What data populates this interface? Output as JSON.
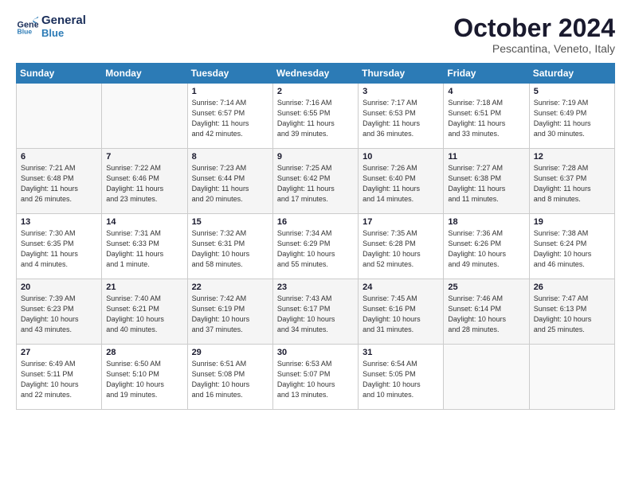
{
  "header": {
    "logo_line1": "General",
    "logo_line2": "Blue",
    "month_title": "October 2024",
    "location": "Pescantina, Veneto, Italy"
  },
  "weekdays": [
    "Sunday",
    "Monday",
    "Tuesday",
    "Wednesday",
    "Thursday",
    "Friday",
    "Saturday"
  ],
  "weeks": [
    [
      {
        "day": "",
        "info": ""
      },
      {
        "day": "",
        "info": ""
      },
      {
        "day": "1",
        "info": "Sunrise: 7:14 AM\nSunset: 6:57 PM\nDaylight: 11 hours\nand 42 minutes."
      },
      {
        "day": "2",
        "info": "Sunrise: 7:16 AM\nSunset: 6:55 PM\nDaylight: 11 hours\nand 39 minutes."
      },
      {
        "day": "3",
        "info": "Sunrise: 7:17 AM\nSunset: 6:53 PM\nDaylight: 11 hours\nand 36 minutes."
      },
      {
        "day": "4",
        "info": "Sunrise: 7:18 AM\nSunset: 6:51 PM\nDaylight: 11 hours\nand 33 minutes."
      },
      {
        "day": "5",
        "info": "Sunrise: 7:19 AM\nSunset: 6:49 PM\nDaylight: 11 hours\nand 30 minutes."
      }
    ],
    [
      {
        "day": "6",
        "info": "Sunrise: 7:21 AM\nSunset: 6:48 PM\nDaylight: 11 hours\nand 26 minutes."
      },
      {
        "day": "7",
        "info": "Sunrise: 7:22 AM\nSunset: 6:46 PM\nDaylight: 11 hours\nand 23 minutes."
      },
      {
        "day": "8",
        "info": "Sunrise: 7:23 AM\nSunset: 6:44 PM\nDaylight: 11 hours\nand 20 minutes."
      },
      {
        "day": "9",
        "info": "Sunrise: 7:25 AM\nSunset: 6:42 PM\nDaylight: 11 hours\nand 17 minutes."
      },
      {
        "day": "10",
        "info": "Sunrise: 7:26 AM\nSunset: 6:40 PM\nDaylight: 11 hours\nand 14 minutes."
      },
      {
        "day": "11",
        "info": "Sunrise: 7:27 AM\nSunset: 6:38 PM\nDaylight: 11 hours\nand 11 minutes."
      },
      {
        "day": "12",
        "info": "Sunrise: 7:28 AM\nSunset: 6:37 PM\nDaylight: 11 hours\nand 8 minutes."
      }
    ],
    [
      {
        "day": "13",
        "info": "Sunrise: 7:30 AM\nSunset: 6:35 PM\nDaylight: 11 hours\nand 4 minutes."
      },
      {
        "day": "14",
        "info": "Sunrise: 7:31 AM\nSunset: 6:33 PM\nDaylight: 11 hours\nand 1 minute."
      },
      {
        "day": "15",
        "info": "Sunrise: 7:32 AM\nSunset: 6:31 PM\nDaylight: 10 hours\nand 58 minutes."
      },
      {
        "day": "16",
        "info": "Sunrise: 7:34 AM\nSunset: 6:29 PM\nDaylight: 10 hours\nand 55 minutes."
      },
      {
        "day": "17",
        "info": "Sunrise: 7:35 AM\nSunset: 6:28 PM\nDaylight: 10 hours\nand 52 minutes."
      },
      {
        "day": "18",
        "info": "Sunrise: 7:36 AM\nSunset: 6:26 PM\nDaylight: 10 hours\nand 49 minutes."
      },
      {
        "day": "19",
        "info": "Sunrise: 7:38 AM\nSunset: 6:24 PM\nDaylight: 10 hours\nand 46 minutes."
      }
    ],
    [
      {
        "day": "20",
        "info": "Sunrise: 7:39 AM\nSunset: 6:23 PM\nDaylight: 10 hours\nand 43 minutes."
      },
      {
        "day": "21",
        "info": "Sunrise: 7:40 AM\nSunset: 6:21 PM\nDaylight: 10 hours\nand 40 minutes."
      },
      {
        "day": "22",
        "info": "Sunrise: 7:42 AM\nSunset: 6:19 PM\nDaylight: 10 hours\nand 37 minutes."
      },
      {
        "day": "23",
        "info": "Sunrise: 7:43 AM\nSunset: 6:17 PM\nDaylight: 10 hours\nand 34 minutes."
      },
      {
        "day": "24",
        "info": "Sunrise: 7:45 AM\nSunset: 6:16 PM\nDaylight: 10 hours\nand 31 minutes."
      },
      {
        "day": "25",
        "info": "Sunrise: 7:46 AM\nSunset: 6:14 PM\nDaylight: 10 hours\nand 28 minutes."
      },
      {
        "day": "26",
        "info": "Sunrise: 7:47 AM\nSunset: 6:13 PM\nDaylight: 10 hours\nand 25 minutes."
      }
    ],
    [
      {
        "day": "27",
        "info": "Sunrise: 6:49 AM\nSunset: 5:11 PM\nDaylight: 10 hours\nand 22 minutes."
      },
      {
        "day": "28",
        "info": "Sunrise: 6:50 AM\nSunset: 5:10 PM\nDaylight: 10 hours\nand 19 minutes."
      },
      {
        "day": "29",
        "info": "Sunrise: 6:51 AM\nSunset: 5:08 PM\nDaylight: 10 hours\nand 16 minutes."
      },
      {
        "day": "30",
        "info": "Sunrise: 6:53 AM\nSunset: 5:07 PM\nDaylight: 10 hours\nand 13 minutes."
      },
      {
        "day": "31",
        "info": "Sunrise: 6:54 AM\nSunset: 5:05 PM\nDaylight: 10 hours\nand 10 minutes."
      },
      {
        "day": "",
        "info": ""
      },
      {
        "day": "",
        "info": ""
      }
    ]
  ]
}
